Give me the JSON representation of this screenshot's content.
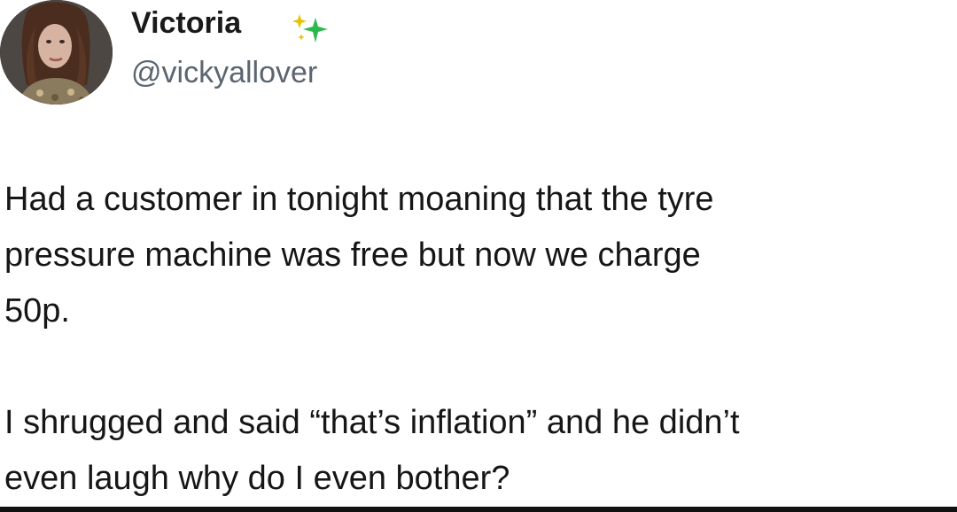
{
  "tweet": {
    "author": {
      "display_name": "Victoria",
      "handle": "@vickyallover",
      "badge_icon": "sparkle-icon"
    },
    "paragraphs": [
      [
        "Had a customer in tonight moaning that the tyre",
        "pressure machine was free but now we charge",
        "50p."
      ],
      [
        "I shrugged and said “that’s inflation” and he didn’t",
        "even laugh why do I even bother?"
      ]
    ]
  },
  "colors": {
    "background": "#ffffff",
    "text": "#161616",
    "handle": "#5b6570",
    "sparkle_gold": "#e8c200",
    "sparkle_green": "#2db84d"
  }
}
